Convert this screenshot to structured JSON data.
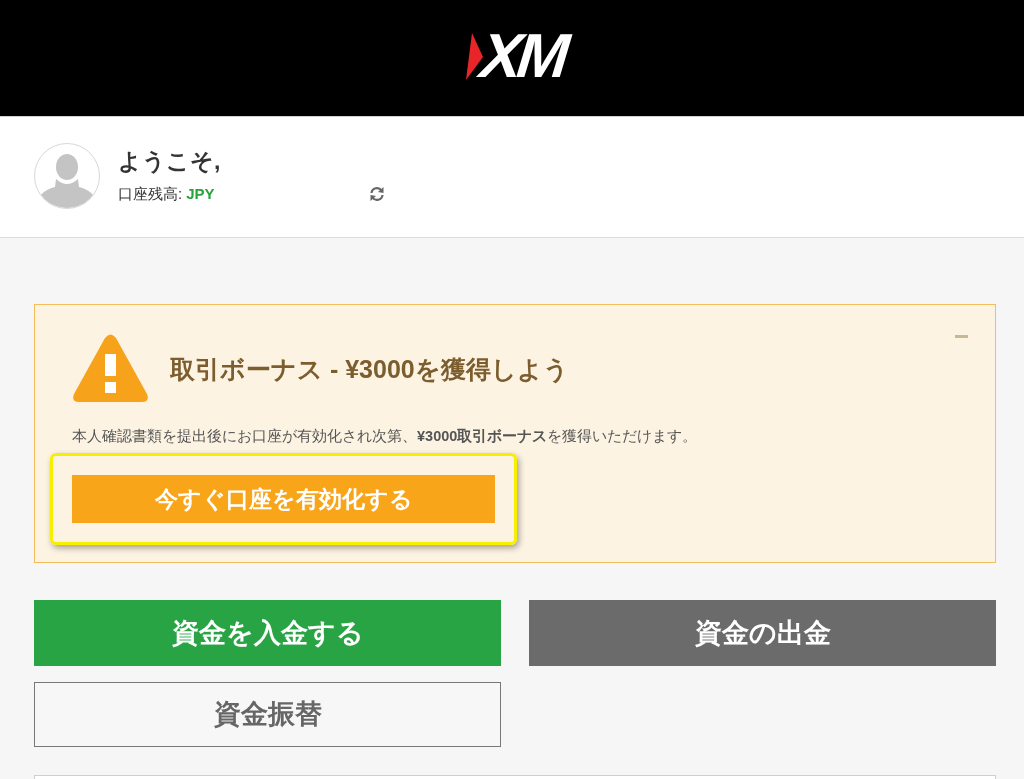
{
  "header": {
    "logo": "XM"
  },
  "profile": {
    "greeting": "ようこそ,",
    "balance_label": "口座残高:",
    "currency": "JPY"
  },
  "bonus_alert": {
    "title": "取引ボーナス - ¥3000を獲得しよう",
    "message": "本人確認書類を提出後にお口座が有効化され次第、**¥3000取引ボーナス**を獲得いただけます。",
    "button": "今すぐ口座を有効化する",
    "highlighted": true
  },
  "actions": [
    {
      "label": "資金を入金する",
      "kind": "primary"
    },
    {
      "label": "資金の出金",
      "kind": "secondary"
    },
    {
      "label": "資金振替",
      "kind": "outline"
    }
  ]
}
